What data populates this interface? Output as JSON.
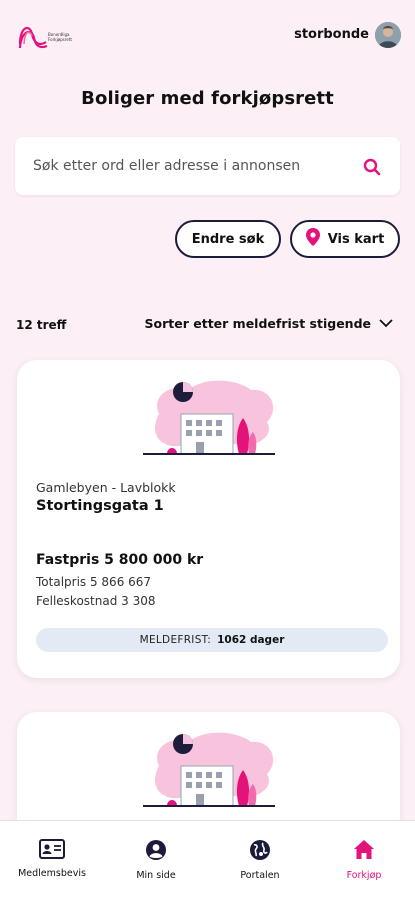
{
  "header": {
    "logo_name": "Bonordliga-logo",
    "logo_text_line1": "Bonordliga",
    "logo_text_line2": "Forkjøpsrett",
    "username": "storbonde"
  },
  "page": {
    "title": "Boliger med forkjøpsrett"
  },
  "search": {
    "placeholder": "Søk etter ord eller adresse i annonsen"
  },
  "actions": {
    "edit_search": "Endre søk",
    "show_map": "Vis kart"
  },
  "results": {
    "count": "12 treff",
    "sort_label": "Sorter etter meldefrist stigende"
  },
  "listings": [
    {
      "area": "Gamlebyen - Lavblokk",
      "street": "Stortingsgata 1",
      "price": "Fastpris 5 800 000 kr",
      "total": "Totalpris 5 866 667",
      "felles": "Felleskostnad 3 308",
      "deadline_key": "MELDEFRIST:",
      "deadline_value": "1062 dager"
    }
  ],
  "tabs": [
    {
      "label": "Medlemsbevis",
      "icon": "id-card-icon"
    },
    {
      "label": "Min side",
      "icon": "user-circle-icon"
    },
    {
      "label": "Portalen",
      "icon": "globe-icon"
    },
    {
      "label": "Forkjøp",
      "icon": "house-icon"
    }
  ],
  "colors": {
    "accent": "#e4137b",
    "background": "#fcf0f6",
    "deadline_bg": "#e3eaf6",
    "dark": "#1b1b3a"
  }
}
